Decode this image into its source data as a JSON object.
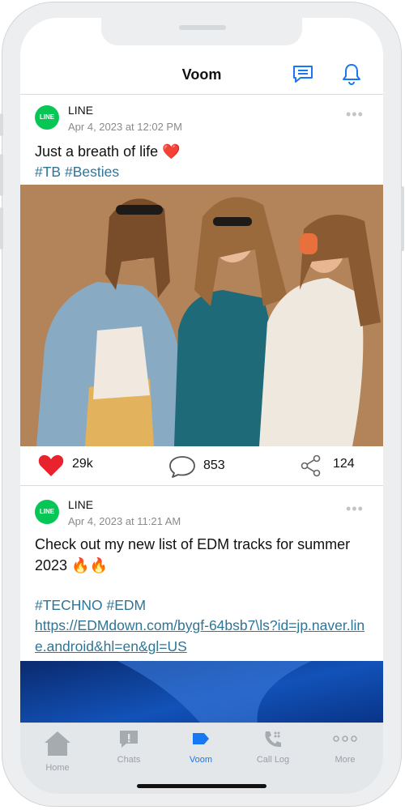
{
  "header": {
    "title": "Voom",
    "icons": [
      "message-icon",
      "bell-icon"
    ]
  },
  "posts": [
    {
      "author": "LINE",
      "avatar_label": "LINE",
      "time": "Apr 4, 2023 at 12:02 PM",
      "text": "Just a breath of life ❤️",
      "tags": "#TB #Besties",
      "likes": "29k",
      "comments": "853",
      "shares": "124"
    },
    {
      "author": "LINE",
      "avatar_label": "LINE",
      "time": "Apr 4, 2023 at 11:21 AM",
      "text": "Check out my new list of EDM tracks for summer 2023 🔥🔥",
      "tags": "#TECHNO #EDM",
      "link": "https://EDMdown.com/bygf-64bsb7\\ls?id=jp.naver.line.android&hl=en&gl=US"
    }
  ],
  "tabs": [
    {
      "label": "Home",
      "icon": "home-icon"
    },
    {
      "label": "Chats",
      "icon": "chat-icon"
    },
    {
      "label": "Voom",
      "icon": "voom-icon",
      "active": true
    },
    {
      "label": "Call Log",
      "icon": "phone-icon"
    },
    {
      "label": "More",
      "icon": "more-icon"
    }
  ],
  "colors": {
    "accent": "#1877f2",
    "line_green": "#06c755",
    "hashtag": "#2e7597",
    "like": "#e8232e"
  }
}
